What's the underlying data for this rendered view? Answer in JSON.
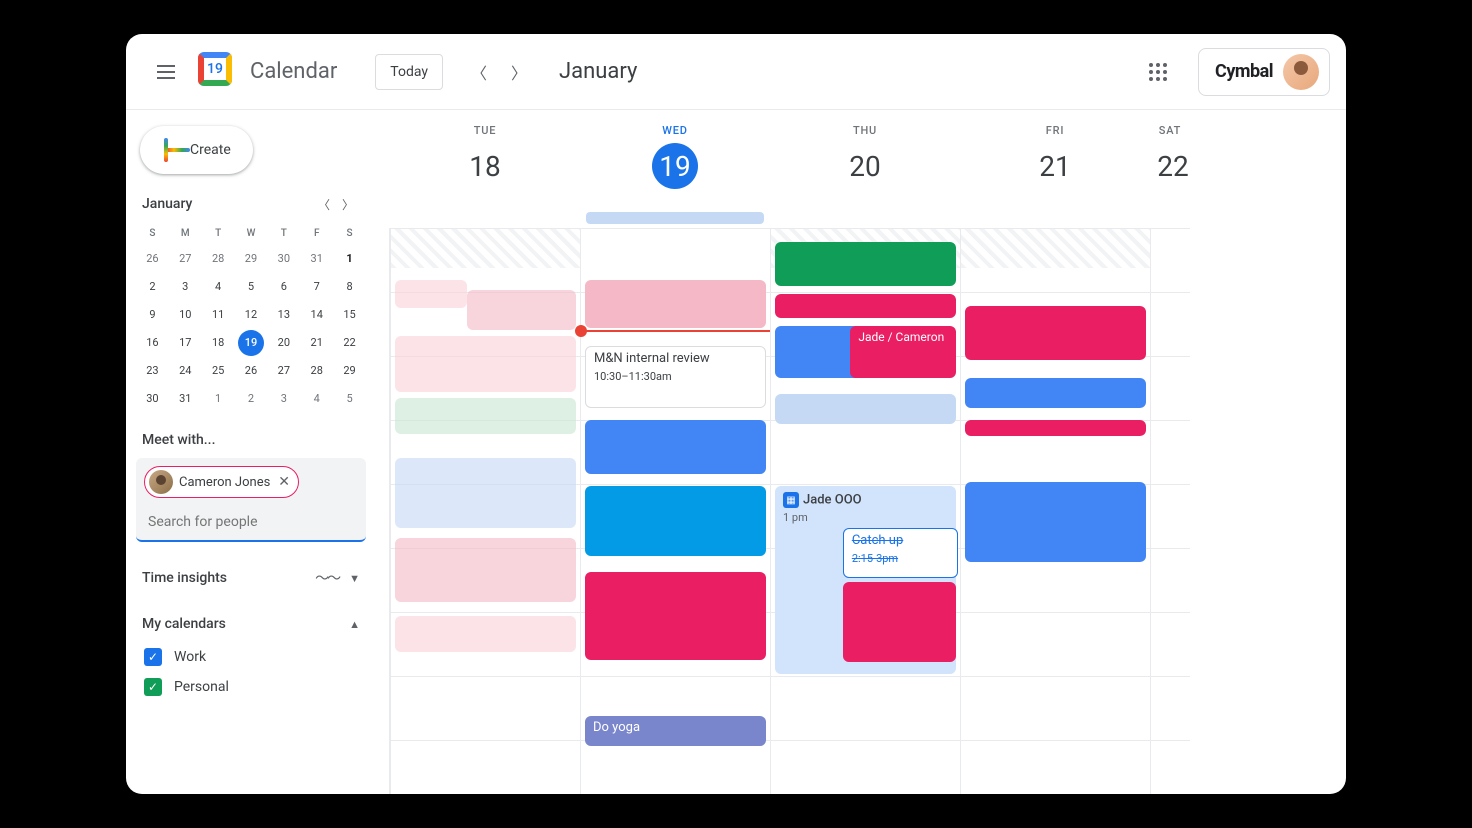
{
  "header": {
    "app_title": "Calendar",
    "today_label": "Today",
    "month_title": "January",
    "org_name": "Cymbal",
    "logo_day": "19"
  },
  "sidebar": {
    "create_label": "Create",
    "mini_month": "January",
    "dow": [
      "S",
      "M",
      "T",
      "W",
      "T",
      "F",
      "S"
    ],
    "mini_days": [
      {
        "d": "26"
      },
      {
        "d": "27"
      },
      {
        "d": "28"
      },
      {
        "d": "29"
      },
      {
        "d": "30"
      },
      {
        "d": "31"
      },
      {
        "d": "1",
        "bold": true
      },
      {
        "d": "2",
        "cur": true
      },
      {
        "d": "3",
        "cur": true
      },
      {
        "d": "4",
        "cur": true
      },
      {
        "d": "5",
        "cur": true
      },
      {
        "d": "6",
        "cur": true
      },
      {
        "d": "7",
        "cur": true
      },
      {
        "d": "8",
        "cur": true
      },
      {
        "d": "9",
        "cur": true
      },
      {
        "d": "10",
        "cur": true
      },
      {
        "d": "11",
        "cur": true
      },
      {
        "d": "12",
        "cur": true
      },
      {
        "d": "13",
        "cur": true
      },
      {
        "d": "14",
        "cur": true
      },
      {
        "d": "15",
        "cur": true
      },
      {
        "d": "16",
        "cur": true
      },
      {
        "d": "17",
        "cur": true
      },
      {
        "d": "18",
        "cur": true
      },
      {
        "d": "19",
        "cur": true,
        "today": true
      },
      {
        "d": "20",
        "cur": true
      },
      {
        "d": "21",
        "cur": true
      },
      {
        "d": "22",
        "cur": true
      },
      {
        "d": "23",
        "cur": true
      },
      {
        "d": "24",
        "cur": true
      },
      {
        "d": "25",
        "cur": true
      },
      {
        "d": "26",
        "cur": true
      },
      {
        "d": "27",
        "cur": true
      },
      {
        "d": "28",
        "cur": true
      },
      {
        "d": "29",
        "cur": true
      },
      {
        "d": "30",
        "cur": true
      },
      {
        "d": "31",
        "cur": true
      },
      {
        "d": "1"
      },
      {
        "d": "2"
      },
      {
        "d": "3"
      },
      {
        "d": "4"
      },
      {
        "d": "5"
      }
    ],
    "meet_label": "Meet with...",
    "chip_name": "Cameron Jones",
    "search_placeholder": "Search for people",
    "time_insights_label": "Time insights",
    "my_calendars_label": "My calendars",
    "calendars": [
      {
        "name": "Work",
        "color": "blue"
      },
      {
        "name": "Personal",
        "color": "green"
      }
    ]
  },
  "days": [
    {
      "dow": "TUE",
      "num": "18"
    },
    {
      "dow": "WED",
      "num": "19",
      "active": true
    },
    {
      "dow": "THU",
      "num": "20"
    },
    {
      "dow": "FRI",
      "num": "21"
    },
    {
      "dow": "SAT",
      "num": "22"
    }
  ],
  "events": {
    "mn_title": "M&N internal review",
    "mn_time": "10:30–11:30am",
    "jade_cameron": "Jade / Cameron",
    "jade_ooo": "Jade OOO",
    "jade_ooo_time": "1 pm",
    "catchup": "Catch up",
    "catchup_time": "2:15-3pm",
    "doyoga": "Do yoga"
  }
}
